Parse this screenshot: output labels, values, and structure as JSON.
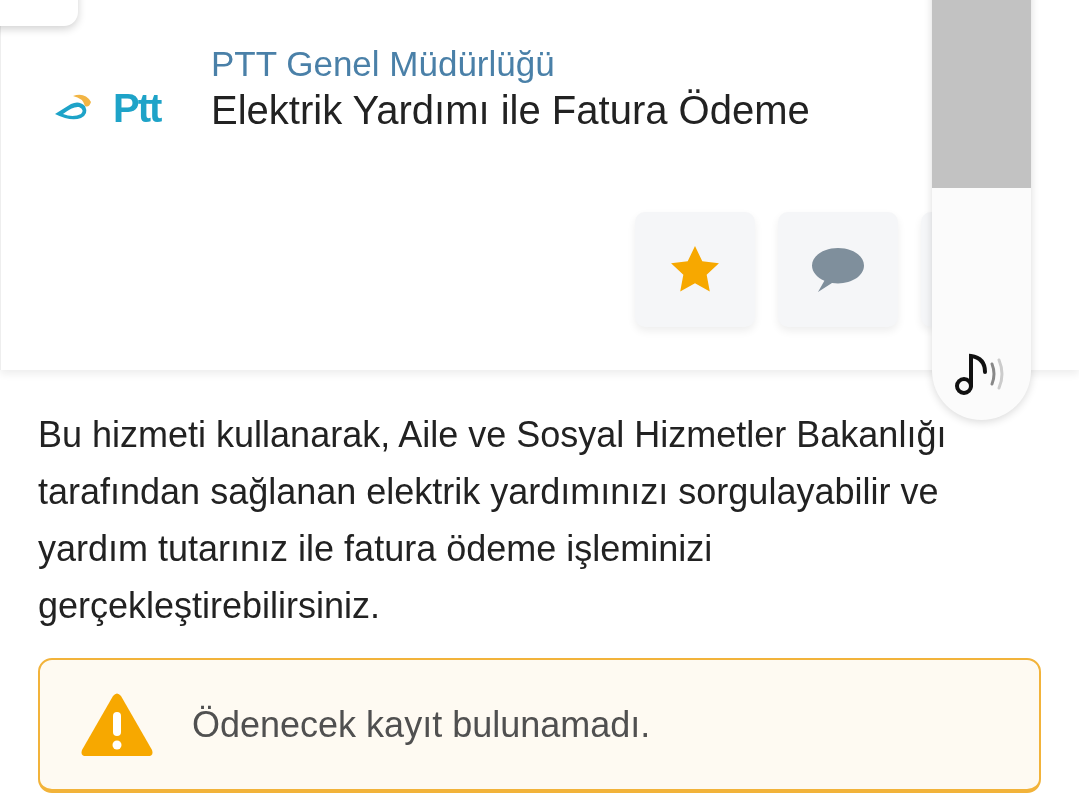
{
  "header": {
    "logo": {
      "text": "Ptt"
    },
    "organization": "PTT Genel Müdürlüğü",
    "title": "Elektrik Yardımı ile Fatura Ödeme",
    "actions": [
      {
        "kind": "favorite"
      },
      {
        "kind": "comment"
      },
      {
        "kind": "covered"
      }
    ]
  },
  "description": "Bu hizmeti kullanarak, Aile ve Sosyal Hizmetler Bakanlığı tarafından sağlanan elektrik yardımınızı sorgulayabilir ve yardım tutarınız ile fatura ödeme işleminizi gerçekleştirebilirsiniz.",
  "alert": {
    "kind": "warning",
    "message": "Ödenecek kayıt bulunamadı."
  }
}
